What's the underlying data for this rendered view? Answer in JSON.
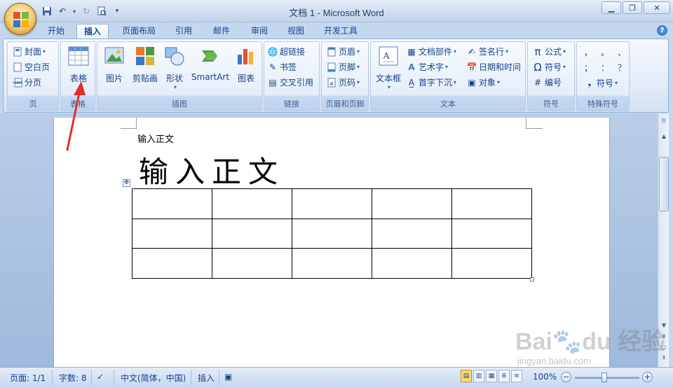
{
  "window": {
    "title": "文档 1 - Microsoft Word"
  },
  "tabs": [
    "开始",
    "插入",
    "页面布局",
    "引用",
    "邮件",
    "审阅",
    "视图",
    "开发工具"
  ],
  "active_tab": "插入",
  "ribbon": {
    "page_group": {
      "label": "页",
      "items": [
        "封面",
        "空白页",
        "分页"
      ]
    },
    "table_group": {
      "label": "表格",
      "button": "表格"
    },
    "illustrations_group": {
      "label": "插图",
      "buttons": [
        "图片",
        "剪贴画",
        "形状",
        "SmartArt",
        "图表"
      ]
    },
    "links_group": {
      "label": "链接",
      "items": [
        "超链接",
        "书签",
        "交叉引用"
      ]
    },
    "header_footer_group": {
      "label": "页眉和页脚",
      "items": [
        "页眉",
        "页脚",
        "页码"
      ]
    },
    "text_group": {
      "label": "文本",
      "big_button": "文本框",
      "items": [
        "文档部件",
        "艺术字",
        "首字下沉",
        "签名行",
        "日期和时间",
        "对象"
      ]
    },
    "symbols_group": {
      "label": "符号",
      "items": [
        "公式",
        "符号",
        "编号"
      ]
    },
    "special_group": {
      "label": "特殊符号",
      "chars": [
        "，",
        "。",
        "、",
        "；",
        "：",
        "？"
      ],
      "symbol_button": "符号"
    }
  },
  "document": {
    "small_text": "输入正文",
    "large_text": "输入正文",
    "table": {
      "rows": 3,
      "cols": 5
    }
  },
  "statusbar": {
    "page": "页面: 1/1",
    "words": "字数: 8",
    "language": "中文(简体，中国)",
    "mode": "插入",
    "zoom": "100%"
  },
  "watermark": {
    "text": "Bai du 经验",
    "url": "jingyan.baidu.com"
  },
  "colors": {
    "arrow": "#e0302a",
    "accent": "#15428b"
  }
}
